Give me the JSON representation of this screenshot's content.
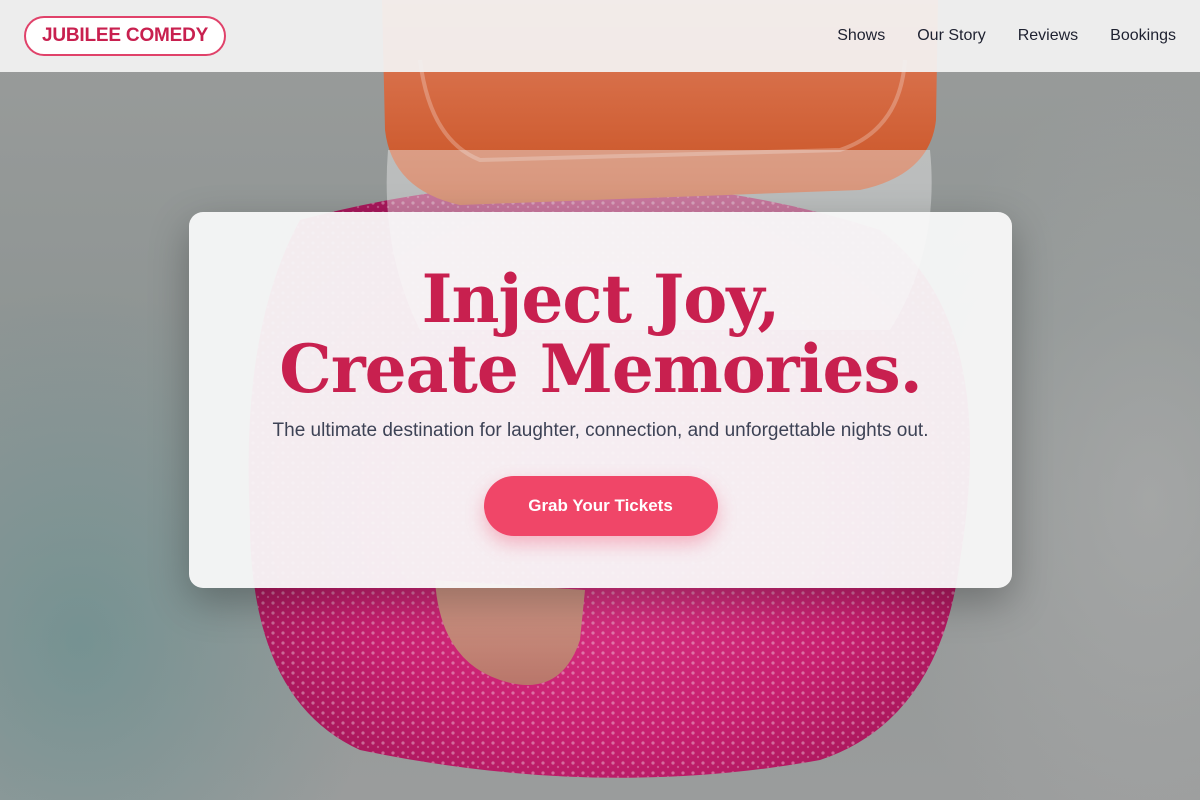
{
  "header": {
    "logo": "JUBILEE COMEDY",
    "nav": [
      "Shows",
      "Our Story",
      "Reviews",
      "Bookings"
    ]
  },
  "hero": {
    "headline_line1": "Inject Joy,",
    "headline_line2": "Create Memories.",
    "subtitle": "The ultimate destination for laughter, connection, and unforgettable nights out.",
    "cta_label": "Grab Your Tickets"
  },
  "colors": {
    "brand": "#c8204f",
    "cta": "#f04668",
    "nav_text": "#1e2130"
  }
}
